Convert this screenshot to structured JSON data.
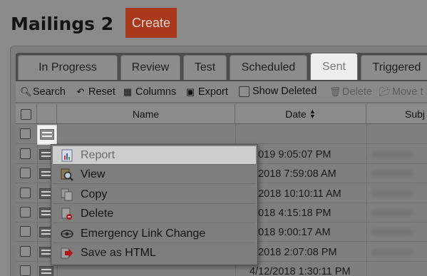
{
  "page": {
    "title": "Mailings 2",
    "create_label": "Create"
  },
  "tabs": [
    {
      "label": "In Progress",
      "active": false
    },
    {
      "label": "Review",
      "active": false
    },
    {
      "label": "Test",
      "active": false
    },
    {
      "label": "Scheduled",
      "active": false
    },
    {
      "label": "Sent",
      "active": true
    },
    {
      "label": "Triggered",
      "active": false
    }
  ],
  "toolbar": {
    "search": "Search",
    "reset": "Reset",
    "columns": "Columns",
    "export": "Export",
    "show_deleted": "Show Deleted",
    "delete": "Delete",
    "move": "Move t"
  },
  "grid": {
    "columns": {
      "name": "Name",
      "date": "Date",
      "subject": "Subj"
    },
    "rows": [
      {
        "date": ""
      },
      {
        "date": "/2019 9:05:07 PM"
      },
      {
        "date": "8/2018 7:59:08 AM"
      },
      {
        "date": "7/2018 10:10:11 AM"
      },
      {
        "date": "/2018 4:15:18 PM"
      },
      {
        "date": "/2018 9:00:17 AM"
      },
      {
        "date": "5/2018 2:07:08 PM"
      },
      {
        "date": "4/12/2018 1:30:11 PM"
      }
    ]
  },
  "context_menu": {
    "items": [
      {
        "label": "Report",
        "icon": "report-icon",
        "hover": true
      },
      {
        "label": "View",
        "icon": "view-icon",
        "hover": false
      },
      {
        "label": "Copy",
        "icon": "copy-icon",
        "hover": false
      },
      {
        "label": "Delete",
        "icon": "delete-document-icon",
        "hover": false
      },
      {
        "label": "Emergency Link Change",
        "icon": "link-change-icon",
        "hover": false
      },
      {
        "label": "Save as HTML",
        "icon": "save-html-icon",
        "hover": false
      }
    ]
  },
  "colors": {
    "create_button": "#a8381c",
    "active_tab": "#eeeeee",
    "overlay": "#8a8a8a"
  }
}
